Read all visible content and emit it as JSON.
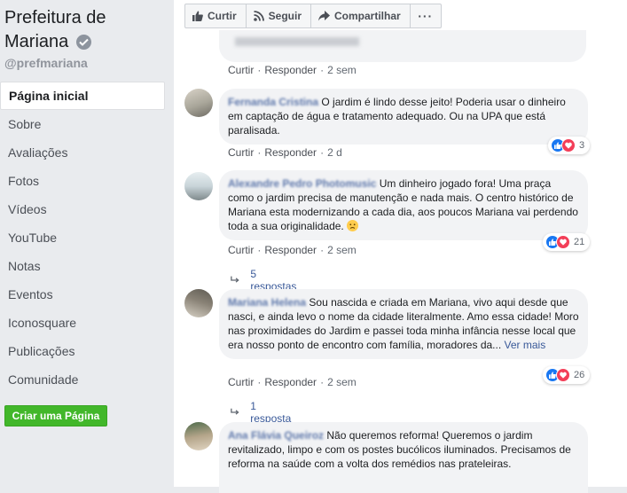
{
  "sidebar": {
    "page_name": "Prefeitura de Mariana",
    "handle": "@prefmariana",
    "nav": [
      {
        "label": "Página inicial",
        "active": true
      },
      {
        "label": "Sobre"
      },
      {
        "label": "Avaliações"
      },
      {
        "label": "Fotos"
      },
      {
        "label": "Vídeos"
      },
      {
        "label": "YouTube"
      },
      {
        "label": "Notas"
      },
      {
        "label": "Eventos"
      },
      {
        "label": "Iconosquare"
      },
      {
        "label": "Publicações"
      },
      {
        "label": "Comunidade"
      }
    ],
    "create_page": "Criar uma Página"
  },
  "actions": {
    "like": "Curtir",
    "follow": "Seguir",
    "share": "Compartilhar",
    "more": "···"
  },
  "comments": [
    {
      "author": "",
      "text": "",
      "meta": {
        "like": "Curtir",
        "reply": "Responder",
        "time": "2 sem"
      }
    },
    {
      "author": "Fernanda Cristina",
      "text": "O jardim é lindo desse jeito! Poderia usar o dinheiro em captação de água e tratamento adequado. Ou na UPA que está paralisada.",
      "meta": {
        "like": "Curtir",
        "reply": "Responder",
        "time": "2 d"
      },
      "reactions": "3"
    },
    {
      "author": "Alexandre Pedro Photomusic",
      "text": "Um dinheiro jogado fora! Uma praça como o jardim precisa de manutenção e nada mais. O centro histórico de Mariana esta modernizando a cada dia, aos poucos Mariana vai perdendo toda a sua originalidade.",
      "meta": {
        "like": "Curtir",
        "reply": "Responder",
        "time": "2 sem"
      },
      "reactions": "21",
      "replies": "5 respostas"
    },
    {
      "author": "Mariana Helena",
      "text": "Sou nascida e criada em Mariana, vivo aqui desde que nasci, e ainda levo o nome da cidade literalmente. Amo essa cidade! Moro nas proximidades do Jardim e passei toda minha infância nesse local que era nosso ponto de encontro com família, moradores da...",
      "see_more": "Ver mais",
      "meta": {
        "like": "Curtir",
        "reply": "Responder",
        "time": "2 sem"
      },
      "reactions": "26",
      "replies": "1 resposta"
    },
    {
      "author": "Ana Flávia Queiroz",
      "text": "Não queremos reforma! Queremos o jardim revitalizado, limpo e com os postes bucólicos iluminados. Precisamos de reforma na saúde com a volta dos remédios nas prateleiras."
    }
  ],
  "colors": {
    "link": "#385898",
    "bubble": "#f2f3f5",
    "create": "#42b72a",
    "like": "#1877f2",
    "love": "#f33e58"
  }
}
